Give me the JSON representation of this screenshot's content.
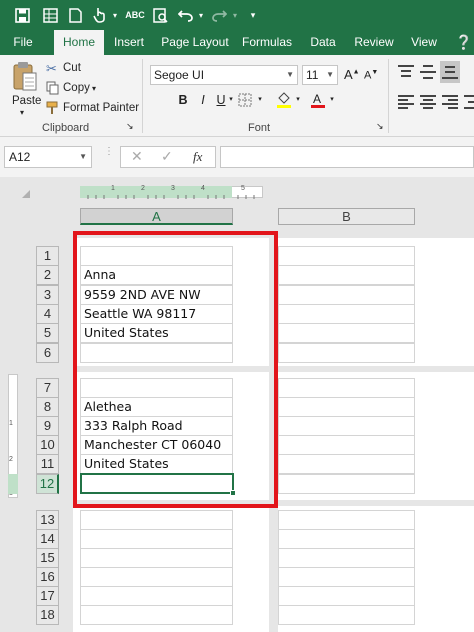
{
  "ribbon": {
    "tabs": [
      "File",
      "Home",
      "Insert",
      "Page Layout",
      "Formulas",
      "Data",
      "Review",
      "View"
    ],
    "active_tab": "Home",
    "clipboard": {
      "paste_label": "Paste",
      "cut_label": "Cut",
      "copy_label": "Copy",
      "format_painter_label": "Format Painter",
      "group_label": "Clipboard"
    },
    "font": {
      "font_name": "Segoe UI",
      "font_size": "11",
      "bold": "B",
      "italic": "I",
      "underline": "U",
      "group_label": "Font"
    }
  },
  "formula_bar": {
    "name_box": "A12",
    "fx_label": "fx",
    "formula": ""
  },
  "sheet": {
    "columns": [
      "A",
      "B"
    ],
    "selected_column": "A",
    "active_cell": "A12",
    "pages": [
      {
        "rows": [
          {
            "num": "1",
            "value": ""
          },
          {
            "num": "2",
            "value": "Anna"
          },
          {
            "num": "3",
            "value": "9559 2ND AVE NW"
          },
          {
            "num": "4",
            "value": "Seattle WA 98117"
          },
          {
            "num": "5",
            "value": "United States"
          },
          {
            "num": "6",
            "value": ""
          }
        ]
      },
      {
        "rows": [
          {
            "num": "7",
            "value": ""
          },
          {
            "num": "8",
            "value": "Alethea"
          },
          {
            "num": "9",
            "value": "333 Ralph Road"
          },
          {
            "num": "10",
            "value": "Manchester CT 06040"
          },
          {
            "num": "11",
            "value": "United States"
          },
          {
            "num": "12",
            "value": ""
          }
        ]
      },
      {
        "rows": [
          {
            "num": "13",
            "value": ""
          },
          {
            "num": "14",
            "value": ""
          },
          {
            "num": "15",
            "value": ""
          },
          {
            "num": "16",
            "value": ""
          },
          {
            "num": "17",
            "value": ""
          },
          {
            "num": "18",
            "value": ""
          }
        ]
      }
    ],
    "ruler_marks": [
      "1",
      "2",
      "3",
      "4",
      "5"
    ],
    "vertical_ruler_marks": [
      "1",
      "2",
      "3"
    ]
  },
  "colors": {
    "excel_green": "#217346",
    "highlight_red": "#e2151b"
  }
}
